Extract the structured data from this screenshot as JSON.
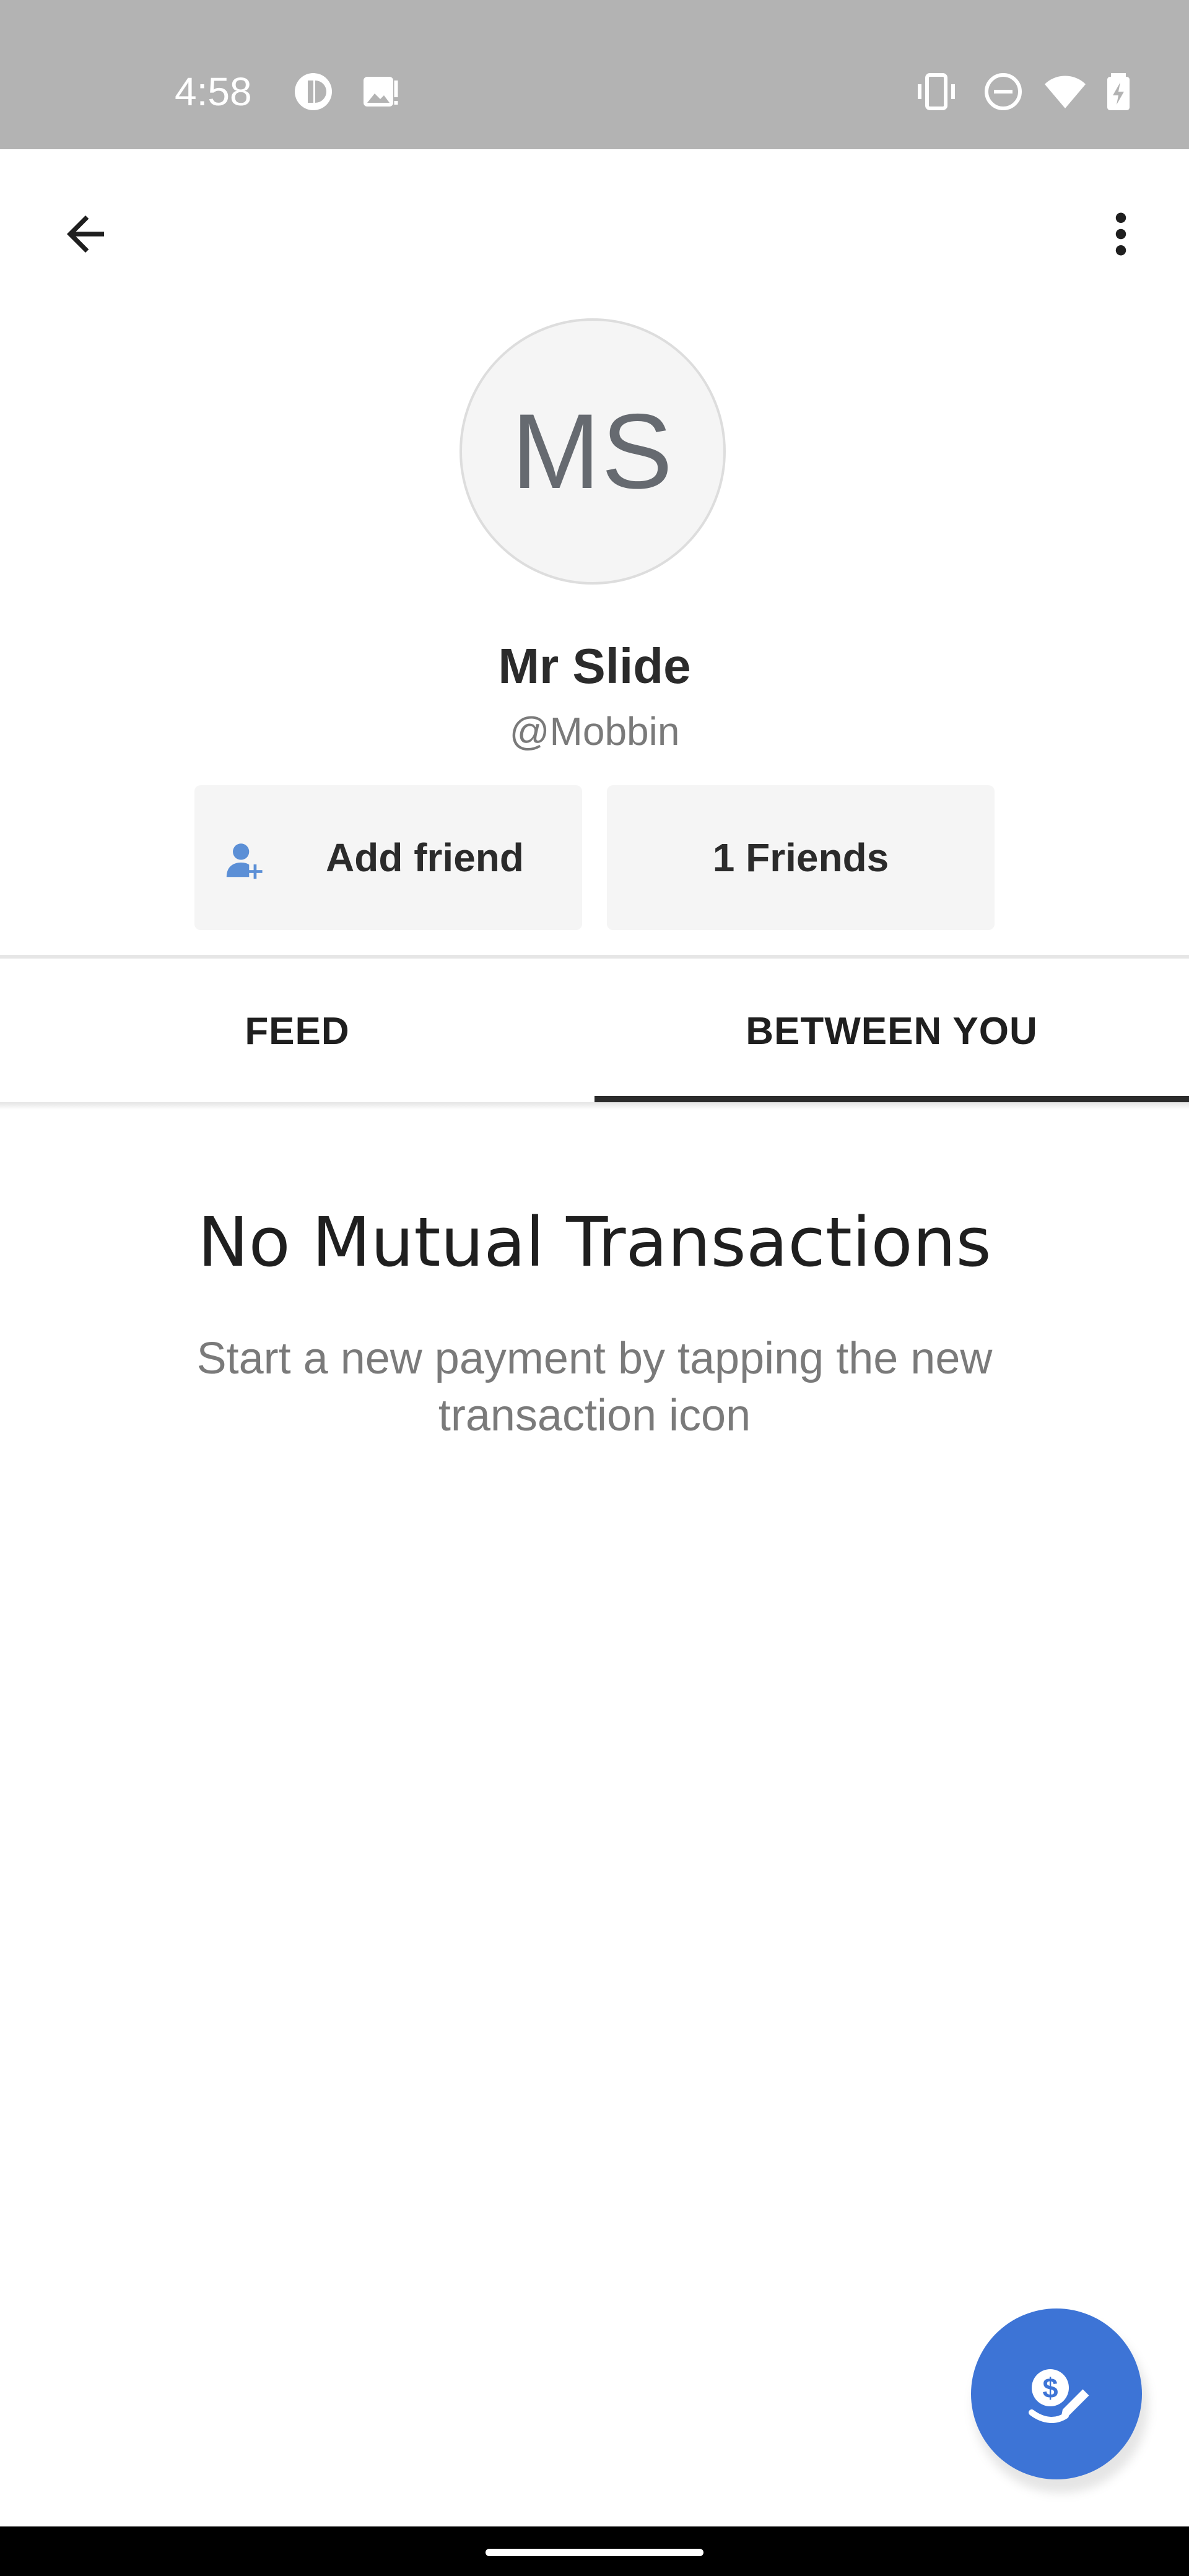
{
  "status_bar": {
    "time": "4:58",
    "icons": [
      "notification-icon",
      "image-alert-icon",
      "vibrate-icon",
      "do-not-disturb-icon",
      "wifi-icon",
      "battery-charging-icon"
    ]
  },
  "app_bar": {
    "back_icon": "arrow-back-icon",
    "more_icon": "more-vertical-icon"
  },
  "profile": {
    "initials": "MS",
    "name": "Mr Slide",
    "handle": "@Mobbin"
  },
  "actions": {
    "add_friend_label": "Add friend",
    "add_friend_icon": "person-add-icon",
    "friends_label": "1 Friends"
  },
  "tabs": [
    {
      "label": "FEED",
      "active": false
    },
    {
      "label": "BETWEEN YOU",
      "active": true
    }
  ],
  "empty_state": {
    "title": "No Mutual Transactions",
    "subtitle": "Start a new payment by tapping the new transaction icon"
  },
  "fab": {
    "icon": "new-transaction-icon"
  },
  "colors": {
    "status_bar": "#b3b3b3",
    "fab": "#3d74d6",
    "accent_icon": "#5b8fd6",
    "tab_indicator": "#2b2b2b"
  }
}
